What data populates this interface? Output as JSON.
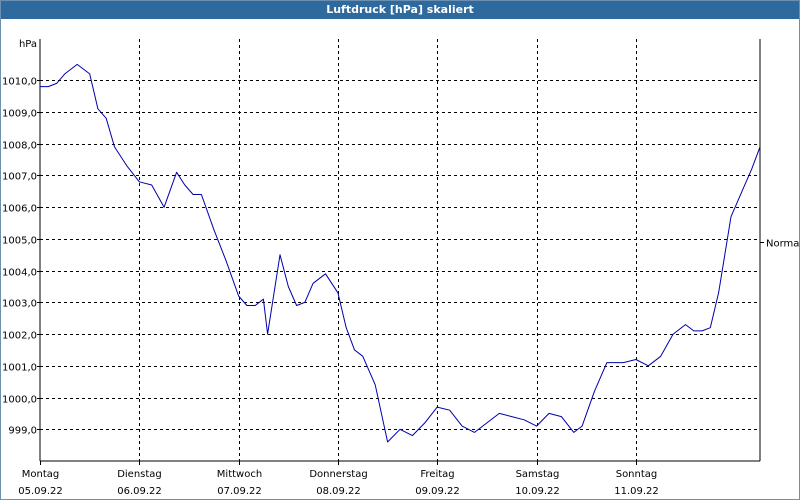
{
  "window": {
    "title": "Luftdruck [hPa] skaliert"
  },
  "chart_data": {
    "type": "line",
    "title": "Luftdruck [hPa] skaliert",
    "ylabel": "hPa",
    "xlabel": "",
    "ylim": [
      998.0,
      1011.3
    ],
    "xlim": [
      "2022-09-05 00:00",
      "2022-09-12 06:00"
    ],
    "grid": true,
    "y_ticks": [
      "1010,0",
      "1009,0",
      "1008,0",
      "1007,0",
      "1006,0",
      "1005,0",
      "1004,0",
      "1003,0",
      "1002,0",
      "1001,0",
      "1000,0",
      "999,0"
    ],
    "x_ticks": [
      {
        "day": "Montag",
        "date": "05.09.22"
      },
      {
        "day": "Dienstag",
        "date": "06.09.22"
      },
      {
        "day": "Mittwoch",
        "date": "07.09.22"
      },
      {
        "day": "Donnerstag",
        "date": "08.09.22"
      },
      {
        "day": "Freitag",
        "date": "09.09.22"
      },
      {
        "day": "Samstag",
        "date": "10.09.22"
      },
      {
        "day": "Sonntag",
        "date": "11.09.22"
      }
    ],
    "reference_line": {
      "label": "Normal",
      "value": 1004.9
    },
    "series": [
      {
        "color": "#0000aa",
        "x": [
          "2022-09-05 00:00",
          "2022-09-05 02:00",
          "2022-09-05 04:00",
          "2022-09-05 06:00",
          "2022-09-05 09:00",
          "2022-09-05 12:00",
          "2022-09-05 14:00",
          "2022-09-05 16:00",
          "2022-09-05 18:00",
          "2022-09-05 21:00",
          "2022-09-06 00:00",
          "2022-09-06 03:00",
          "2022-09-06 06:00",
          "2022-09-06 09:00",
          "2022-09-06 11:00",
          "2022-09-06 13:00",
          "2022-09-06 15:00",
          "2022-09-06 18:00",
          "2022-09-06 21:00",
          "2022-09-07 00:00",
          "2022-09-07 02:00",
          "2022-09-07 04:00",
          "2022-09-07 06:00",
          "2022-09-07 07:00",
          "2022-09-07 10:00",
          "2022-09-07 12:00",
          "2022-09-07 14:00",
          "2022-09-07 16:00",
          "2022-09-07 18:00",
          "2022-09-07 21:00",
          "2022-09-08 00:00",
          "2022-09-08 02:00",
          "2022-09-08 04:00",
          "2022-09-08 06:00",
          "2022-09-08 09:00",
          "2022-09-08 12:00",
          "2022-09-08 15:00",
          "2022-09-08 18:00",
          "2022-09-08 21:00",
          "2022-09-09 00:00",
          "2022-09-09 03:00",
          "2022-09-09 06:00",
          "2022-09-09 09:00",
          "2022-09-09 12:00",
          "2022-09-09 15:00",
          "2022-09-09 18:00",
          "2022-09-09 21:00",
          "2022-09-10 00:00",
          "2022-09-10 03:00",
          "2022-09-10 06:00",
          "2022-09-10 09:00",
          "2022-09-10 11:00",
          "2022-09-10 14:00",
          "2022-09-10 17:00",
          "2022-09-10 21:00",
          "2022-09-11 00:00",
          "2022-09-11 03:00",
          "2022-09-11 06:00",
          "2022-09-11 09:00",
          "2022-09-11 12:00",
          "2022-09-11 14:00",
          "2022-09-11 16:00",
          "2022-09-11 18:00",
          "2022-09-11 20:00",
          "2022-09-11 23:00",
          "2022-09-12 02:00",
          "2022-09-12 04:00",
          "2022-09-12 06:00"
        ],
        "y": [
          1009.8,
          1009.8,
          1009.9,
          1010.2,
          1010.5,
          1010.2,
          1009.1,
          1008.8,
          1007.9,
          1007.3,
          1006.8,
          1006.7,
          1006.0,
          1007.1,
          1006.7,
          1006.4,
          1006.4,
          1005.3,
          1004.3,
          1003.2,
          1002.9,
          1002.9,
          1003.1,
          1002.0,
          1004.5,
          1003.5,
          1002.9,
          1003.0,
          1003.6,
          1003.9,
          1003.3,
          1002.2,
          1001.5,
          1001.3,
          1000.4,
          998.6,
          999.0,
          998.8,
          999.2,
          999.7,
          999.6,
          999.1,
          998.9,
          999.2,
          999.5,
          999.4,
          999.3,
          999.1,
          999.5,
          999.4,
          998.9,
          999.1,
          1000.2,
          1001.1,
          1001.1,
          1001.2,
          1001.0,
          1001.3,
          1002.0,
          1002.3,
          1002.1,
          1002.1,
          1002.2,
          1003.3,
          1005.7,
          1006.6,
          1007.2,
          1007.9
        ]
      }
    ]
  }
}
